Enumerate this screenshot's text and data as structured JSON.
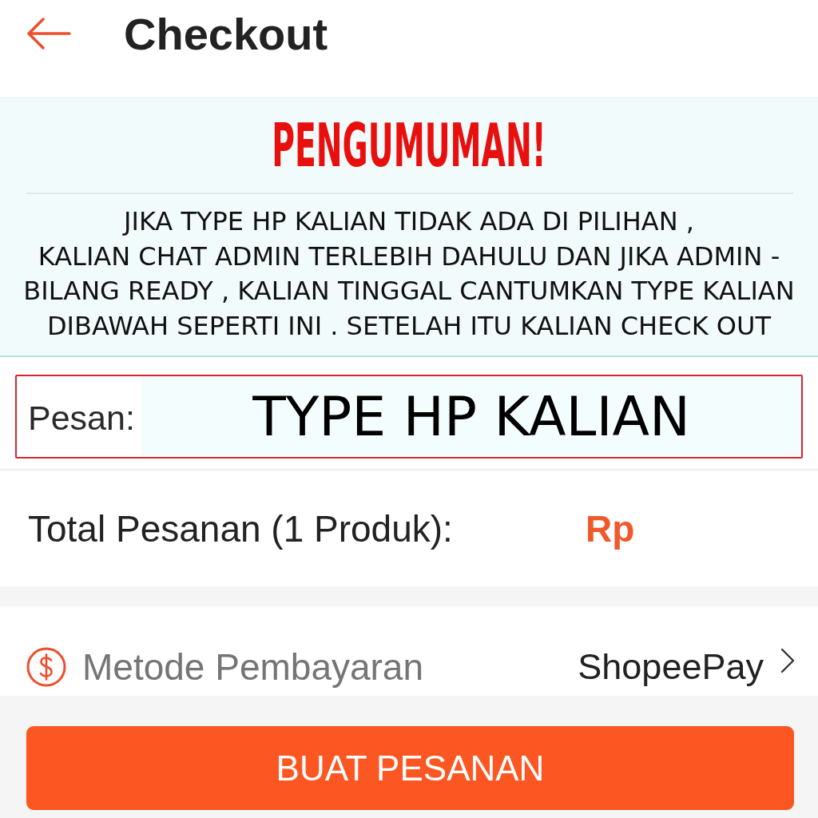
{
  "header": {
    "title": "Checkout"
  },
  "announcement": {
    "title": "PENGUMUMAN!",
    "lines": [
      "JIKA TYPE HP KALIAN TIDAK ADA DI PILIHAN ,",
      "KALIAN CHAT ADMIN TERLEBIH DAHULU DAN JIKA ADMIN -",
      "BILANG READY , KALIAN TINGGAL CANTUMKAN TYPE KALIAN",
      "DIBAWAH SEPERTI INI . SETELAH ITU KALIAN CHECK OUT"
    ]
  },
  "message": {
    "label": "Pesan:",
    "value": "TYPE HP KALIAN"
  },
  "total": {
    "label": "Total Pesanan (1 Produk):",
    "amount": "Rp"
  },
  "payment": {
    "label": "Metode Pembayaran",
    "value": "ShopeePay"
  },
  "button": {
    "label": "BUAT PESANAN"
  }
}
